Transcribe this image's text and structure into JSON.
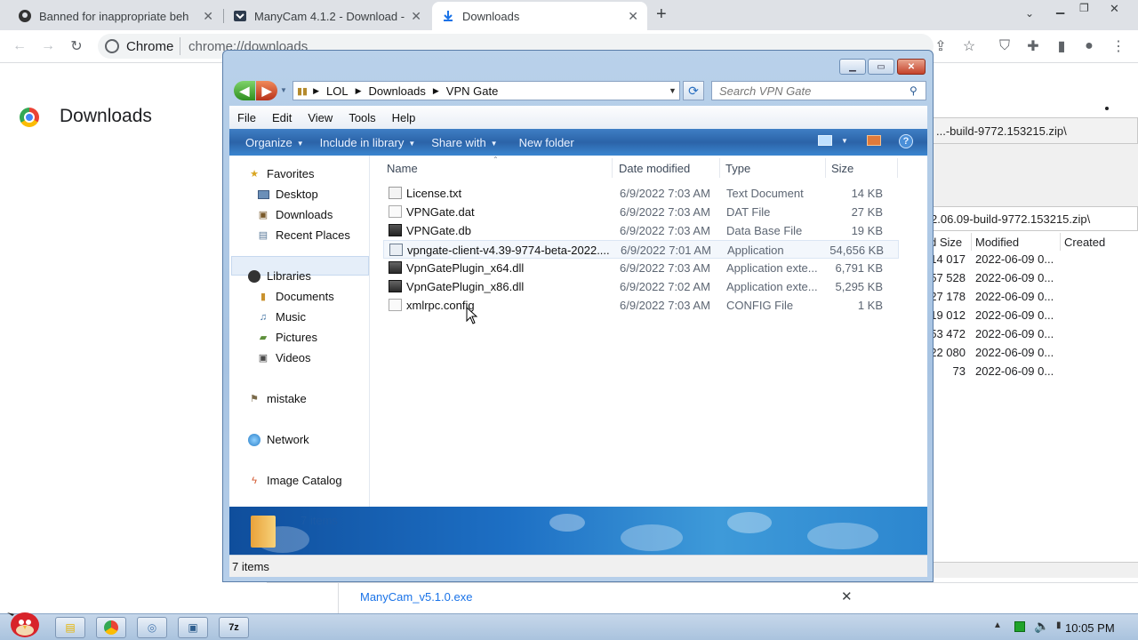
{
  "chrome": {
    "tabs": [
      {
        "label": "Banned for inappropriate beh",
        "icon": "github-icon",
        "active": false
      },
      {
        "label": "ManyCam 4.1.2 - Download -",
        "icon": "download-site-icon",
        "active": false
      },
      {
        "label": "Downloads",
        "icon": "download-icon",
        "active": true
      }
    ],
    "new_tab": "+",
    "omnibox_site": "Chrome",
    "omnibox_url": "chrome://downloads",
    "page_title": "Downloads"
  },
  "background_7zip": {
    "path": "...-build-9772.153215.zip\\",
    "path2": "2.06.09-build-9772.153215.zip\\",
    "columns": [
      "d Size",
      "Modified",
      "Created"
    ],
    "rows": [
      {
        "size": "14 017",
        "modified": "2022-06-09 0..."
      },
      {
        "size": "57 528",
        "modified": "2022-06-09 0..."
      },
      {
        "size": "27 178",
        "modified": "2022-06-09 0..."
      },
      {
        "size": "19 012",
        "modified": "2022-06-09 0..."
      },
      {
        "size": "53 472",
        "modified": "2022-06-09 0..."
      },
      {
        "size": "22 080",
        "modified": "2022-06-09 0..."
      },
      {
        "size": "73",
        "modified": "2022-06-09 0..."
      }
    ]
  },
  "explorer": {
    "breadcrumb": [
      "LOL",
      "Downloads",
      "VPN Gate"
    ],
    "search_placeholder": "Search VPN Gate",
    "menu": [
      "File",
      "Edit",
      "View",
      "Tools",
      "Help"
    ],
    "commands": [
      {
        "label": "Organize",
        "dropdown": true
      },
      {
        "label": "Include in library",
        "dropdown": true
      },
      {
        "label": "Share with",
        "dropdown": true
      },
      {
        "label": "New folder",
        "dropdown": false
      }
    ],
    "nav": {
      "favorites": {
        "label": "Favorites",
        "items": [
          "Desktop",
          "Downloads",
          "Recent Places"
        ]
      },
      "libraries": {
        "label": "Libraries",
        "items": [
          "Documents",
          "Music",
          "Pictures",
          "Videos"
        ]
      },
      "homegroup": "mistake",
      "network": "Network",
      "catalog": "Image Catalog"
    },
    "columns": {
      "name": "Name",
      "date": "Date modified",
      "type": "Type",
      "size": "Size"
    },
    "files": [
      {
        "name": "License.txt",
        "date": "6/9/2022 7:03 AM",
        "type": "Text Document",
        "size": "14 KB",
        "icon": "text-file-icon"
      },
      {
        "name": "VPNGate.dat",
        "date": "6/9/2022 7:03 AM",
        "type": "DAT File",
        "size": "27 KB",
        "icon": "generic-file-icon"
      },
      {
        "name": "VPNGate.db",
        "date": "6/9/2022 7:03 AM",
        "type": "Data Base File",
        "size": "19 KB",
        "icon": "db-file-icon"
      },
      {
        "name": "vpngate-client-v4.39-9774-beta-2022....",
        "date": "6/9/2022 7:01 AM",
        "type": "Application",
        "size": "54,656 KB",
        "icon": "app-file-icon"
      },
      {
        "name": "VpnGatePlugin_x64.dll",
        "date": "6/9/2022 7:03 AM",
        "type": "Application exte...",
        "size": "6,791 KB",
        "icon": "dll-file-icon"
      },
      {
        "name": "VpnGatePlugin_x86.dll",
        "date": "6/9/2022 7:02 AM",
        "type": "Application exte...",
        "size": "5,295 KB",
        "icon": "dll-file-icon"
      },
      {
        "name": "xmlrpc.config",
        "date": "6/9/2022 7:03 AM",
        "type": "CONFIG File",
        "size": "1 KB",
        "icon": "generic-file-icon"
      }
    ],
    "details_count": "7 items",
    "status": "7 items"
  },
  "download_bar": {
    "filename": "ManyCam_v5.1.0.exe"
  },
  "taskbar": {
    "clock": "10:05 PM"
  }
}
